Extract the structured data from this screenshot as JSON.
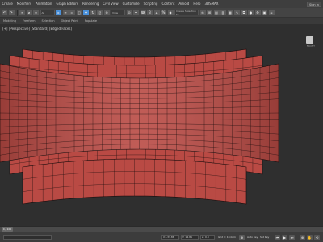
{
  "menu": [
    "Create",
    "Modifiers",
    "Animation",
    "Graph Editors",
    "Rendering",
    "Civil View",
    "Customize",
    "Scripting",
    "Content",
    "Arnold",
    "Help",
    "3DSMAX"
  ],
  "sign_in": "Sign in",
  "toolbar": {
    "filter_dropdown": "All",
    "view_dropdown": "View",
    "selection_set": "Create Selection Se"
  },
  "ribbon_tabs": [
    {
      "label": "Modeling",
      "active": false
    },
    {
      "label": "Freeform",
      "active": false
    },
    {
      "label": "Selection",
      "active": false
    },
    {
      "label": "Object Paint",
      "active": false
    },
    {
      "label": "Populate",
      "active": false
    }
  ],
  "viewport": {
    "label": "[+] [Perspective] [Standard] [Edged Faces]",
    "viewcube_label": "FRONT",
    "mesh_color": "#b94a44",
    "wire_color": "#1a0d0d",
    "background": "#2f2f2f"
  },
  "status": {
    "frame": "0 / 100",
    "x": "X: -33.86",
    "y": "Y: 14.81",
    "z": "Z: 0.0",
    "grid": "Grid = 10.0cm",
    "autokey": "Auto Key",
    "setkey": "Set Key",
    "selected": "Selected",
    "key_filters": "Key Filters..."
  }
}
